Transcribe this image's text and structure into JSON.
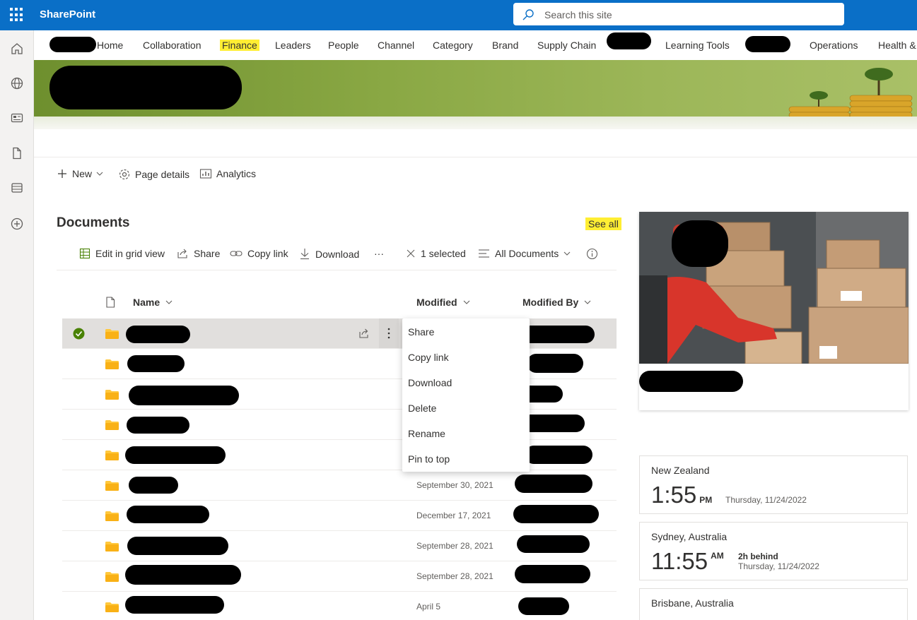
{
  "app": {
    "brand": "SharePoint"
  },
  "search": {
    "placeholder": "Search this site"
  },
  "nav": {
    "items": [
      "Home",
      "Collaboration",
      "Finance",
      "Leaders",
      "People",
      "Channel",
      "Category",
      "Brand",
      "Supply Chain",
      "Learning Tools",
      "Operations",
      "Health &"
    ]
  },
  "commandbar": {
    "new": "New",
    "page_details": "Page details",
    "analytics": "Analytics"
  },
  "documents": {
    "title": "Documents",
    "see_all": "See all",
    "toolbar": {
      "edit_grid": "Edit in grid view",
      "share": "Share",
      "copy_link": "Copy link",
      "download": "Download",
      "more": "···",
      "selected": "1 selected",
      "view": "All Documents"
    },
    "columns": {
      "name": "Name",
      "modified": "Modified",
      "modified_by": "Modified By"
    },
    "rows": [
      {
        "modified": ""
      },
      {
        "modified": ""
      },
      {
        "modified": ""
      },
      {
        "modified": ""
      },
      {
        "modified": ""
      },
      {
        "modified": "September 30, 2021"
      },
      {
        "modified": "December 17, 2021"
      },
      {
        "modified": "September 28, 2021"
      },
      {
        "modified": "September 28, 2021"
      },
      {
        "modified": "April 5"
      }
    ]
  },
  "context_menu": {
    "items": [
      "Share",
      "Copy link",
      "Download",
      "Delete",
      "Rename",
      "Pin to top"
    ]
  },
  "clocks": [
    {
      "city": "New Zealand",
      "time": "1:55",
      "ampm": "PM",
      "date": "Thursday, 11/24/2022",
      "diff": ""
    },
    {
      "city": "Sydney, Australia",
      "time": "11:55",
      "ampm": "AM",
      "date": "Thursday, 11/24/2022",
      "diff": "2h behind"
    },
    {
      "city": "Brisbane, Australia"
    }
  ],
  "colors": {
    "brand_blue": "#0a6fc7",
    "highlight": "#ffee33",
    "folder": "#ffc83d",
    "check_green": "#498205"
  }
}
